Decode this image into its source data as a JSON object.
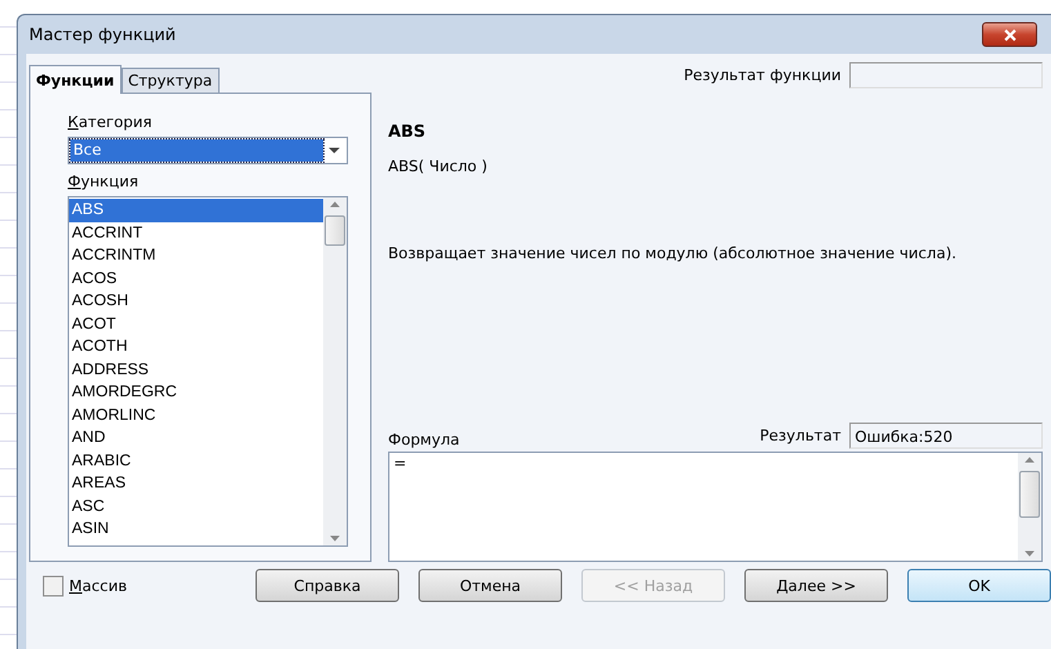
{
  "window": {
    "title": "Мастер функций"
  },
  "tabs": [
    {
      "label": "Функции",
      "selected": true
    },
    {
      "label": "Структура",
      "selected": false
    }
  ],
  "category": {
    "label": "Категория",
    "value": "Все"
  },
  "function_list": {
    "label": "Функция",
    "items": [
      {
        "label": "ABS",
        "selected": true
      },
      {
        "label": "ACCRINT",
        "selected": false
      },
      {
        "label": "ACCRINTM",
        "selected": false
      },
      {
        "label": "ACOS",
        "selected": false
      },
      {
        "label": "ACOSH",
        "selected": false
      },
      {
        "label": "ACOT",
        "selected": false
      },
      {
        "label": "ACOTH",
        "selected": false
      },
      {
        "label": "ADDRESS",
        "selected": false
      },
      {
        "label": "AMORDEGRC",
        "selected": false
      },
      {
        "label": "AMORLINC",
        "selected": false
      },
      {
        "label": "AND",
        "selected": false
      },
      {
        "label": "ARABIC",
        "selected": false
      },
      {
        "label": "AREAS",
        "selected": false
      },
      {
        "label": "ASC",
        "selected": false
      },
      {
        "label": "ASIN",
        "selected": false
      }
    ]
  },
  "function_result": {
    "label": "Результат функции"
  },
  "function_name": "ABS",
  "syntax": "ABS( Число )",
  "description": "Возвращает значение чисел по модулю (абсолютное значение числа).",
  "formula": {
    "label": "Формула",
    "value": "="
  },
  "result": {
    "label": "Результат",
    "value": "Ошибка:520"
  },
  "array_checkbox": {
    "label": "Массив",
    "checked": false
  },
  "buttons": [
    {
      "label": "Справка",
      "disabled": false,
      "default": false
    },
    {
      "label": "Отмена",
      "disabled": false,
      "default": false
    },
    {
      "label": "<< Назад",
      "disabled": true,
      "default": false
    },
    {
      "label": "Далее >>",
      "disabled": false,
      "default": false
    },
    {
      "label": "OK",
      "disabled": false,
      "default": true
    }
  ]
}
